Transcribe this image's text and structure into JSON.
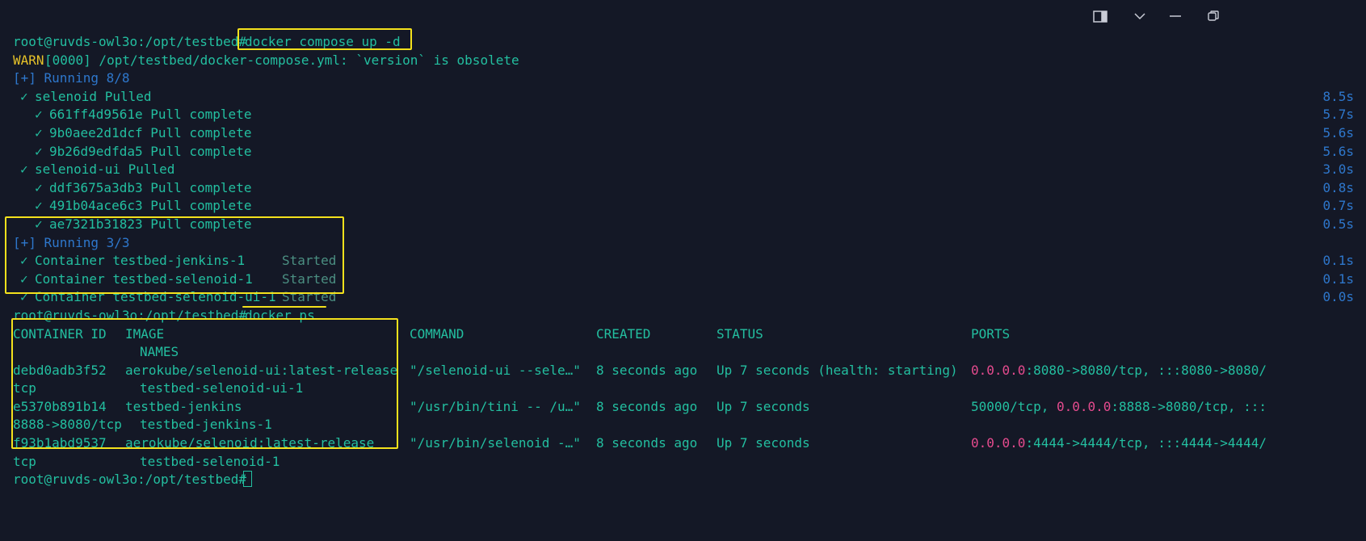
{
  "window": {
    "buttons": [
      {
        "name": "toggle-sidebar-button",
        "icon": "sidebar-icon"
      },
      {
        "name": "dropdown-button",
        "icon": "chevron-down-icon"
      },
      {
        "name": "minimize-button",
        "icon": "minimize-icon"
      },
      {
        "name": "restore-button",
        "icon": "restore-icon"
      }
    ]
  },
  "terminal": {
    "prompt": "root@ruvds-owl3o:/opt/testbed#",
    "cmd1": "docker compose up -d",
    "warn_prefix": "WARN",
    "warn_text": "[0000] /opt/testbed/docker-compose.yml: `version` is obsolete",
    "running1": "[+] Running 8/8",
    "check": "✓",
    "pulls": [
      {
        "indent": 1,
        "text": "selenoid Pulled",
        "time": "8.5s"
      },
      {
        "indent": 3,
        "text": "661ff4d9561e Pull complete",
        "time": "5.7s"
      },
      {
        "indent": 3,
        "text": "9b0aee2d1dcf Pull complete",
        "time": "5.6s"
      },
      {
        "indent": 3,
        "text": "9b26d9edfda5 Pull complete",
        "time": "5.6s"
      },
      {
        "indent": 1,
        "text": "selenoid-ui Pulled",
        "time": "3.0s"
      },
      {
        "indent": 3,
        "text": "ddf3675a3db3 Pull complete",
        "time": "0.8s"
      },
      {
        "indent": 3,
        "text": "491b04ace6c3 Pull complete",
        "time": "0.7s"
      },
      {
        "indent": 3,
        "text": "ae7321b31823 Pull complete",
        "time": "0.5s"
      }
    ],
    "running2": "[+] Running 3/3",
    "containers": [
      {
        "name": "Container testbed-jenkins-1",
        "status": "Started",
        "time": "0.1s"
      },
      {
        "name": "Container testbed-selenoid-1",
        "status": "Started",
        "time": "0.1s"
      },
      {
        "name": "Container testbed-selenoid-ui-1",
        "status": "Started",
        "time": "0.0s"
      }
    ],
    "cmd2": "docker ps",
    "ps_headers": {
      "container_id": "CONTAINER ID",
      "image": "IMAGE",
      "command": "COMMAND",
      "created": "CREATED",
      "status": "STATUS",
      "ports": "PORTS",
      "names": "NAMES"
    },
    "ps_rows": [
      {
        "id": "debd0adb3f52",
        "image": "aerokube/selenoid-ui:latest-release",
        "command": "\"/selenoid-ui --sele…\"",
        "created": "8 seconds ago",
        "status": "Up 7 seconds (health: starting)",
        "ports_pink1": "0.0.0.0",
        "ports_mid": ":8080->8080/tcp, :::8080->8080/",
        "ports_tail": "",
        "wrap": "tcp",
        "names": "testbed-selenoid-ui-1"
      },
      {
        "id": "e5370b891b14",
        "image": "testbed-jenkins",
        "command": "\"/usr/bin/tini -- /u…\"",
        "created": "8 seconds ago",
        "status": "Up 7 seconds",
        "ports_pre": "50000/tcp, ",
        "ports_pink1": "0.0.0.0",
        "ports_mid": ":8888->8080/tcp, :::",
        "wrap": "8888->8080/tcp",
        "names": "testbed-jenkins-1"
      },
      {
        "id": "f93b1abd9537",
        "image": "aerokube/selenoid:latest-release",
        "command": "\"/usr/bin/selenoid -…\"",
        "created": "8 seconds ago",
        "status": "Up 7 seconds",
        "ports_pink1": "0.0.0.0",
        "ports_mid": ":4444->4444/tcp, :::4444->4444/",
        "wrap": "tcp",
        "names": "testbed-selenoid-1"
      }
    ]
  },
  "colors": {
    "background": "#141826",
    "text_green": "#23bfa0",
    "text_blue": "#2e77cc",
    "warn_yellow": "#e6c229",
    "ip_pink": "#e54b8e",
    "highlight_yellow": "#f4e11c"
  }
}
